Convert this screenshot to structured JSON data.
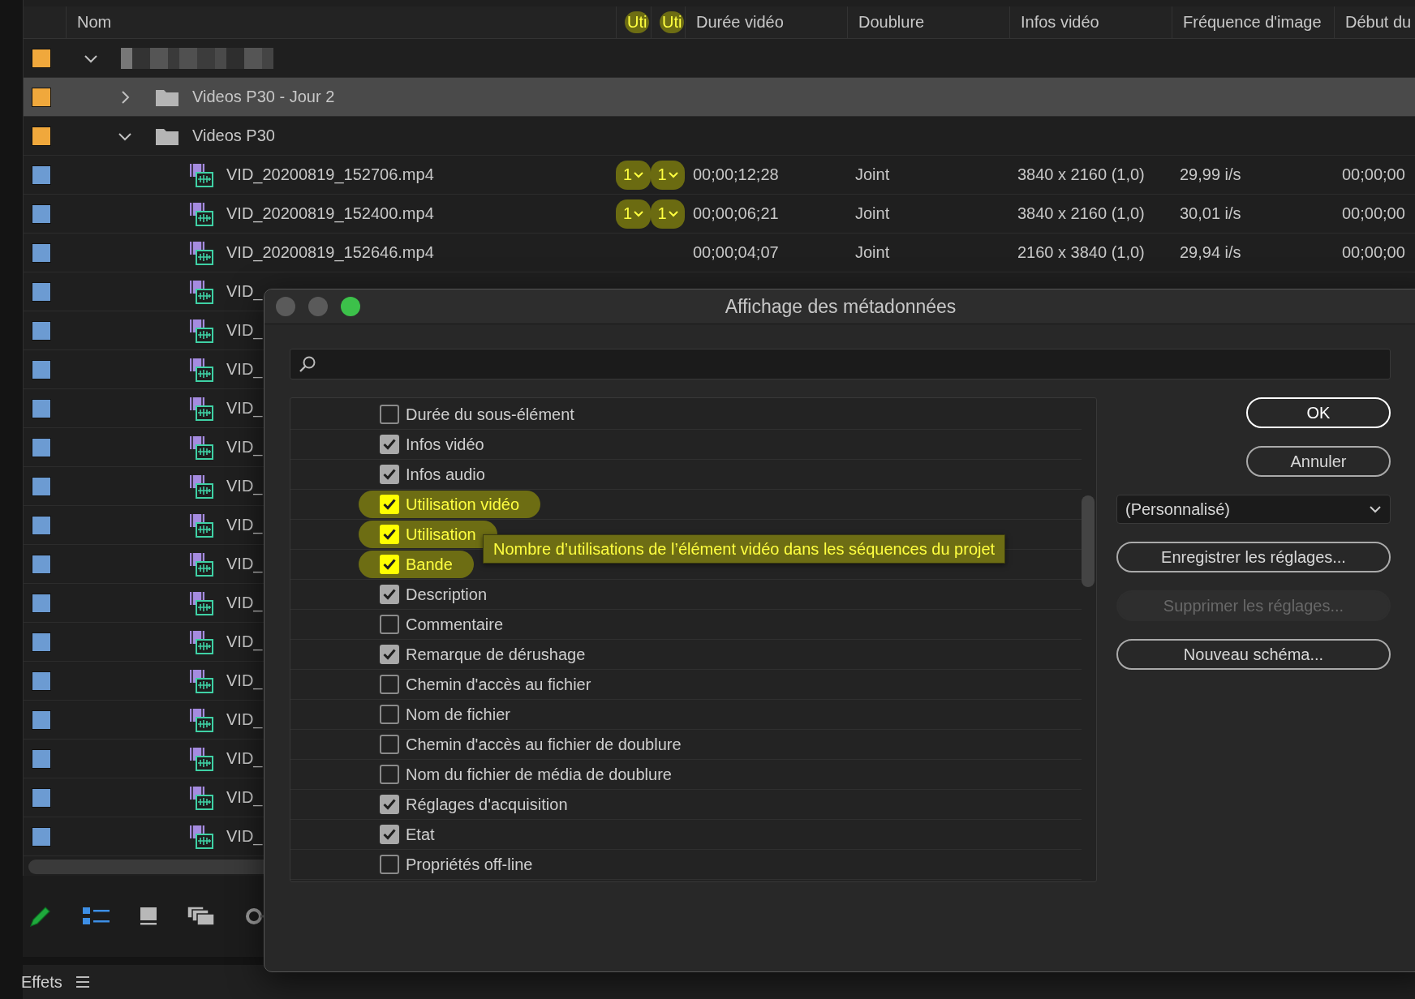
{
  "project_panel": {
    "columns": [
      {
        "label": "Nom",
        "highlighted": false
      },
      {
        "label": "Uti",
        "highlighted": true
      },
      {
        "label": "Uti",
        "highlighted": true
      },
      {
        "label": "Durée vidéo",
        "highlighted": false
      },
      {
        "label": "Doublure",
        "highlighted": false
      },
      {
        "label": "Infos vidéo",
        "highlighted": false
      },
      {
        "label": "Fréquence d'image",
        "highlighted": false
      },
      {
        "label": "Début du",
        "highlighted": false
      }
    ],
    "items": [
      {
        "kind": "bin",
        "name_hidden": true,
        "color": "#f0a83c",
        "expanded": true,
        "selected": false,
        "children": [
          {
            "kind": "bin",
            "name": "Videos P30 - Jour 2",
            "color": "#f0a83c",
            "expanded": false,
            "selected": true
          },
          {
            "kind": "bin",
            "name": "Videos P30",
            "color": "#f0a83c",
            "expanded": true,
            "selected": false,
            "children": [
              {
                "kind": "clip",
                "name": "VID_20200819_152706.mp4",
                "color": "#6c9bd2",
                "selected": false,
                "uses": [
                  {
                    "text": "1",
                    "highlighted": true
                  },
                  {
                    "text": "1",
                    "highlighted": true
                  }
                ],
                "cells": [
                  "00;00;12;28",
                  "Joint",
                  "3840 x 2160 (1,0)",
                  "29,99 i/s",
                  "00;00;00"
                ]
              },
              {
                "kind": "clip",
                "name": "VID_20200819_152400.mp4",
                "color": "#6c9bd2",
                "selected": false,
                "uses": [
                  {
                    "text": "1",
                    "highlighted": true
                  },
                  {
                    "text": "1",
                    "highlighted": true
                  }
                ],
                "cells": [
                  "00;00;06;21",
                  "Joint",
                  "3840 x 2160 (1,0)",
                  "30,01 i/s",
                  "00;00;00"
                ]
              },
              {
                "kind": "clip",
                "name": "VID_20200819_152646.mp4",
                "color": "#6c9bd2",
                "selected": false,
                "cells": [
                  "00;00;04;07",
                  "Joint",
                  "2160 x 3840 (1,0)",
                  "29,94 i/s",
                  "00;00;00"
                ]
              },
              {
                "kind": "clip",
                "name": "VID_",
                "color": "#6c9bd2",
                "selected": false
              },
              {
                "kind": "clip",
                "name": "VID_",
                "color": "#6c9bd2",
                "selected": false
              },
              {
                "kind": "clip",
                "name": "VID_",
                "color": "#6c9bd2",
                "selected": false
              },
              {
                "kind": "clip",
                "name": "VID_",
                "color": "#6c9bd2",
                "selected": false
              },
              {
                "kind": "clip",
                "name": "VID_",
                "color": "#6c9bd2",
                "selected": false
              },
              {
                "kind": "clip",
                "name": "VID_",
                "color": "#6c9bd2",
                "selected": false
              },
              {
                "kind": "clip",
                "name": "VID_",
                "color": "#6c9bd2",
                "selected": false
              },
              {
                "kind": "clip",
                "name": "VID_",
                "color": "#6c9bd2",
                "selected": false
              },
              {
                "kind": "clip",
                "name": "VID_",
                "color": "#6c9bd2",
                "selected": false
              },
              {
                "kind": "clip",
                "name": "VID_",
                "color": "#6c9bd2",
                "selected": false
              },
              {
                "kind": "clip",
                "name": "VID_",
                "color": "#6c9bd2",
                "selected": false
              },
              {
                "kind": "clip",
                "name": "VID_",
                "color": "#6c9bd2",
                "selected": false
              },
              {
                "kind": "clip",
                "name": "VID_",
                "color": "#6c9bd2",
                "selected": false
              },
              {
                "kind": "clip",
                "name": "VID_",
                "color": "#6c9bd2",
                "selected": false
              },
              {
                "kind": "clip",
                "name": "VID_",
                "color": "#6c9bd2",
                "selected": false
              }
            ]
          }
        ]
      }
    ]
  },
  "toolbar": [
    {
      "kind": "pencil"
    },
    {
      "kind": "list_view",
      "selected": true
    },
    {
      "kind": "icon_view",
      "selected": false
    },
    {
      "kind": "freeform_view",
      "selected": false
    },
    {
      "kind": "zoom_slider"
    }
  ],
  "effects_panel": {
    "title": "Effets"
  },
  "dialog": {
    "title": "Affichage des métadonnées",
    "fields": [
      {
        "label": "Durée du sous-élément",
        "checked": false,
        "highlighted": false
      },
      {
        "label": "Infos vidéo",
        "checked": true,
        "highlighted": false
      },
      {
        "label": "Infos audio",
        "checked": true,
        "highlighted": false
      },
      {
        "label": "Utilisation vidéo",
        "checked": true,
        "highlighted": true
      },
      {
        "label": "Utilisation",
        "checked": true,
        "highlighted": true
      },
      {
        "label": "Bande",
        "checked": true,
        "highlighted": true
      },
      {
        "label": "Description",
        "checked": true,
        "highlighted": false
      },
      {
        "label": "Commentaire",
        "checked": false,
        "highlighted": false
      },
      {
        "label": "Remarque de dérushage",
        "checked": true,
        "highlighted": false
      },
      {
        "label": "Chemin d'accès au fichier",
        "checked": false,
        "highlighted": false
      },
      {
        "label": "Nom de fichier",
        "checked": false,
        "highlighted": false
      },
      {
        "label": "Chemin d'accès au fichier de doublure",
        "checked": false,
        "highlighted": false
      },
      {
        "label": "Nom du fichier de média de doublure",
        "checked": false,
        "highlighted": false
      },
      {
        "label": "Réglages d'acquisition",
        "checked": true,
        "highlighted": false
      },
      {
        "label": "Etat",
        "checked": true,
        "highlighted": false
      },
      {
        "label": "Propriétés off-line",
        "checked": false,
        "highlighted": false
      }
    ],
    "tooltip": "Nombre d’utilisations de l’élément vidéo dans les séquences du projet",
    "buttons": [
      {
        "kind": "default",
        "label": "OK"
      },
      {
        "kind": "normal",
        "label": "Annuler"
      }
    ],
    "preset": "(Personnalisé)",
    "actions": [
      {
        "label": "Enregistrer les réglages...",
        "disabled": false
      },
      {
        "label": "Supprimer les réglages...",
        "disabled": true
      },
      {
        "label": "Nouveau schéma...",
        "disabled": false
      }
    ]
  }
}
